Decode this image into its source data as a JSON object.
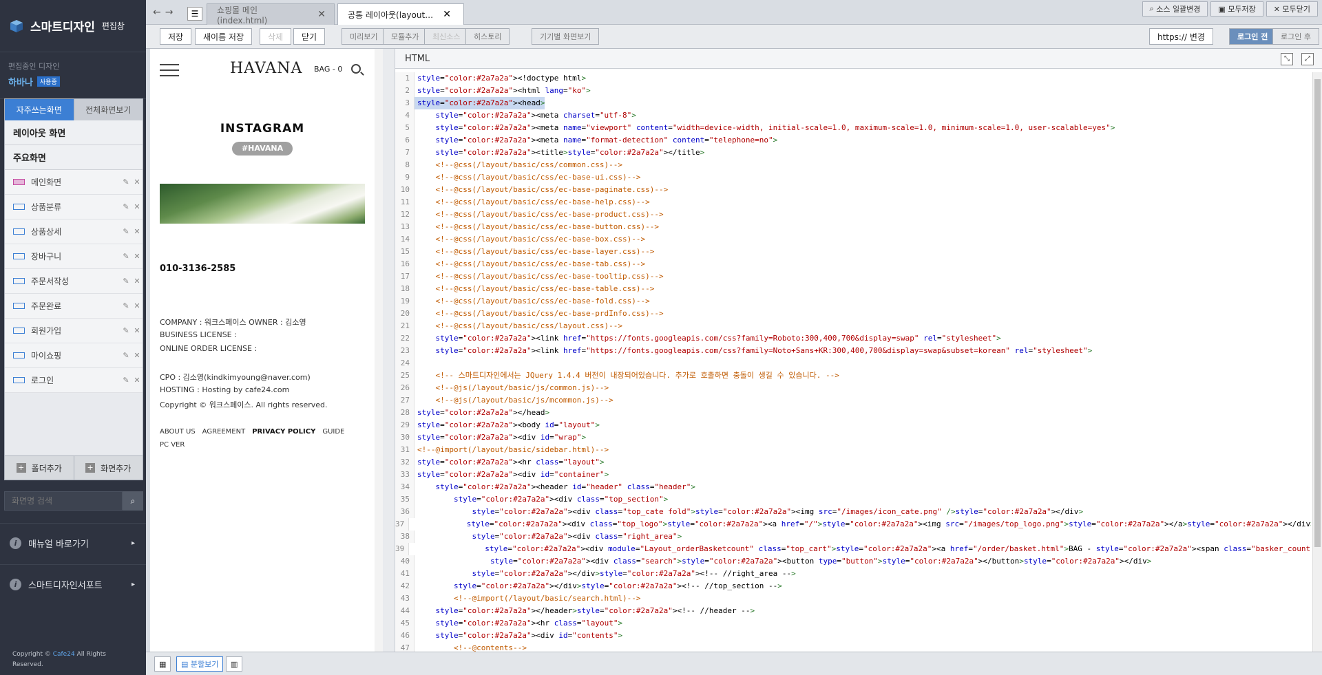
{
  "sidebar": {
    "brand": "스마트디자인",
    "brand_sub": "편집창",
    "editing_label": "편집중인 디자인",
    "design_name": "하바나",
    "design_badge": "사용중",
    "tabs": [
      "자주쓰는화면",
      "전체화면보기"
    ],
    "sections": [
      "레이아웃 화면",
      "주요화면"
    ],
    "items": [
      "메인화면",
      "상품분류",
      "상품상세",
      "장바구니",
      "주문서작성",
      "주문완료",
      "회원가입",
      "마이쇼핑",
      "로그인"
    ],
    "folder_add": "폴더추가",
    "page_add": "화면추가",
    "search_placeholder": "화면명 검색",
    "links": [
      "매뉴얼 바로가기",
      "스마트디자인서포트"
    ],
    "copyright": "Copyright ©",
    "copyright_brand": "Cafe24",
    "copyright_tail": "All Rights Reserved."
  },
  "tabs": {
    "file_tabs": [
      "쇼핑몰 메인(index.html)",
      "공통 레이아웃(layout…"
    ],
    "right_buttons": [
      "소스 일괄변경",
      "모두저장",
      "모두닫기"
    ]
  },
  "toolbar": {
    "save": "저장",
    "save_as": "새이름 저장",
    "delete": "삭제",
    "close": "닫기",
    "preview": "미리보기",
    "add_module": "모듈추가",
    "latest": "최신소스",
    "history": "히스토리",
    "device": "기기별 화면보기",
    "https": "https:// 변경",
    "login_before": "로그인 전",
    "login_after": "로그인 후"
  },
  "preview": {
    "logo": "HAVANA",
    "bag": "BAG - 0",
    "instagram": "INSTAGRAM",
    "hashtag": "#HAVANA",
    "phone": "010-3136-2585",
    "company": "COMPANY : 워크스페이스    OWNER : 김소영",
    "business": "BUSINESS LICENSE :",
    "online": "ONLINE ORDER LICENSE :",
    "cpo": "CPO : 김소영(kindkimyoung@naver.com)",
    "hosting": "HOSTING : Hosting by cafe24.com",
    "copyright": "Copyright © 워크스페이스. All rights reserved.",
    "footer_links": [
      "ABOUT US",
      "AGREEMENT",
      "PRIVACY POLICY",
      "GUIDE"
    ],
    "pc_ver": "PC VER"
  },
  "editor": {
    "title": "HTML",
    "lines": [
      "<!doctype html>",
      "<html lang=\"ko\">",
      "<head>",
      "    <meta charset=\"utf-8\">",
      "    <meta name=\"viewport\" content=\"width=device-width, initial-scale=1.0, maximum-scale=1.0, minimum-scale=1.0, user-scalable=yes\">",
      "    <meta name=\"format-detection\" content=\"telephone=no\">",
      "    <title></title>",
      "    <!--@css(/layout/basic/css/common.css)-->",
      "    <!--@css(/layout/basic/css/ec-base-ui.css)-->",
      "    <!--@css(/layout/basic/css/ec-base-paginate.css)-->",
      "    <!--@css(/layout/basic/css/ec-base-help.css)-->",
      "    <!--@css(/layout/basic/css/ec-base-product.css)-->",
      "    <!--@css(/layout/basic/css/ec-base-button.css)-->",
      "    <!--@css(/layout/basic/css/ec-base-box.css)-->",
      "    <!--@css(/layout/basic/css/ec-base-layer.css)-->",
      "    <!--@css(/layout/basic/css/ec-base-tab.css)-->",
      "    <!--@css(/layout/basic/css/ec-base-tooltip.css)-->",
      "    <!--@css(/layout/basic/css/ec-base-table.css)-->",
      "    <!--@css(/layout/basic/css/ec-base-fold.css)-->",
      "    <!--@css(/layout/basic/css/ec-base-prdInfo.css)-->",
      "    <!--@css(/layout/basic/css/layout.css)-->",
      "    <link href=\"https://fonts.googleapis.com/css?family=Roboto:300,400,700&display=swap\" rel=\"stylesheet\">",
      "    <link href=\"https://fonts.googleapis.com/css?family=Noto+Sans+KR:300,400,700&display=swap&subset=korean\" rel=\"stylesheet\">",
      "",
      "    <!-- 스마트디자인에서는 JQuery 1.4.4 버전이 내장되어있습니다. 추가로 호출하면 충돌이 생길 수 있습니다. -->",
      "    <!--@js(/layout/basic/js/common.js)-->",
      "    <!--@js(/layout/basic/js/mcommon.js)-->",
      "</head>",
      "<body id=\"layout\">",
      "<div id=\"wrap\">",
      "<!--@import(/layout/basic/sidebar.html)-->",
      "<hr class=\"layout\">",
      "<div id=\"container\">",
      "    <header id=\"header\" class=\"header\">",
      "        <div class=\"top_section\">",
      "            <div class=\"top_cate fold\"><img src=\"/images/icon_cate.png\" /></div>",
      "            <div class=\"top_logo\"><a href=\"/\"><img src=\"/images/top_logo.png\"></a></div>",
      "            <div class=\"right_area\">",
      "                <div module=\"Layout_orderBasketcount\" class=\"top_cart\"><a href=\"/order/basket.html\">BAG - <span class=\"basker_count\">{$basket_count}</span></a></div>",
      "                <div class=\"search\"><button type=\"button\"></button></div>",
      "            </div><!-- //right_area -->",
      "        </div><!-- //top_section -->",
      "        <!--@import(/layout/basic/search.html)-->",
      "    </header><!-- //header -->",
      "    <hr class=\"layout\">",
      "    <div id=\"contents\">",
      "        <!--@contents-->"
    ]
  },
  "status": {
    "split_view": "분할보기"
  },
  "colors": {
    "accent": "#3c7fd4",
    "sidebar_bg": "#2e3340",
    "tag": "#2a7a2a",
    "attr": "#0000c8",
    "value": "#b00000",
    "comment": "#c05a00"
  }
}
